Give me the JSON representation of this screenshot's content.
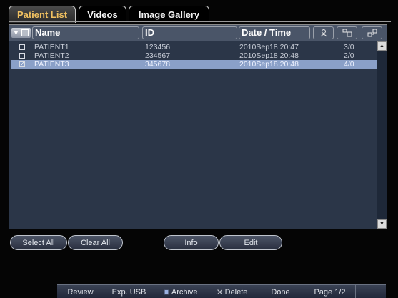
{
  "tabs": [
    {
      "label": "Patient List"
    },
    {
      "label": "Videos"
    },
    {
      "label": "Image Gallery"
    }
  ],
  "table": {
    "columns": {
      "name": "Name",
      "id": "ID",
      "datetime": "Date / Time",
      "icon1": "person-icon",
      "icon2": "images-icon",
      "icon3": "network-icon"
    },
    "rows": [
      {
        "name": "PATIENT1",
        "id": "123456",
        "datetime": "2010Sep18  20:47",
        "count": "3/0",
        "checked": "false"
      },
      {
        "name": "PATIENT2",
        "id": "234567",
        "datetime": "2010Sep18  20:48",
        "count": "2/0",
        "checked": "false"
      },
      {
        "name": "PATIENT3",
        "id": "345678",
        "datetime": "2010Sep18  20:48",
        "count": "4/0",
        "checked": "true"
      }
    ]
  },
  "buttons": {
    "select_all": "Select All",
    "clear_all": "Clear All",
    "info": "Info",
    "edit": "Edit"
  },
  "bottom_bar": {
    "review": "Review",
    "exp_usb": "Exp. USB",
    "archive": "Archive",
    "delete": "Delete",
    "done": "Done",
    "page": "Page 1/2"
  },
  "colors": {
    "active_tab_text": "#f0c060",
    "panel_bg": "#2b3648",
    "selected_row": "#8aa0c8"
  }
}
